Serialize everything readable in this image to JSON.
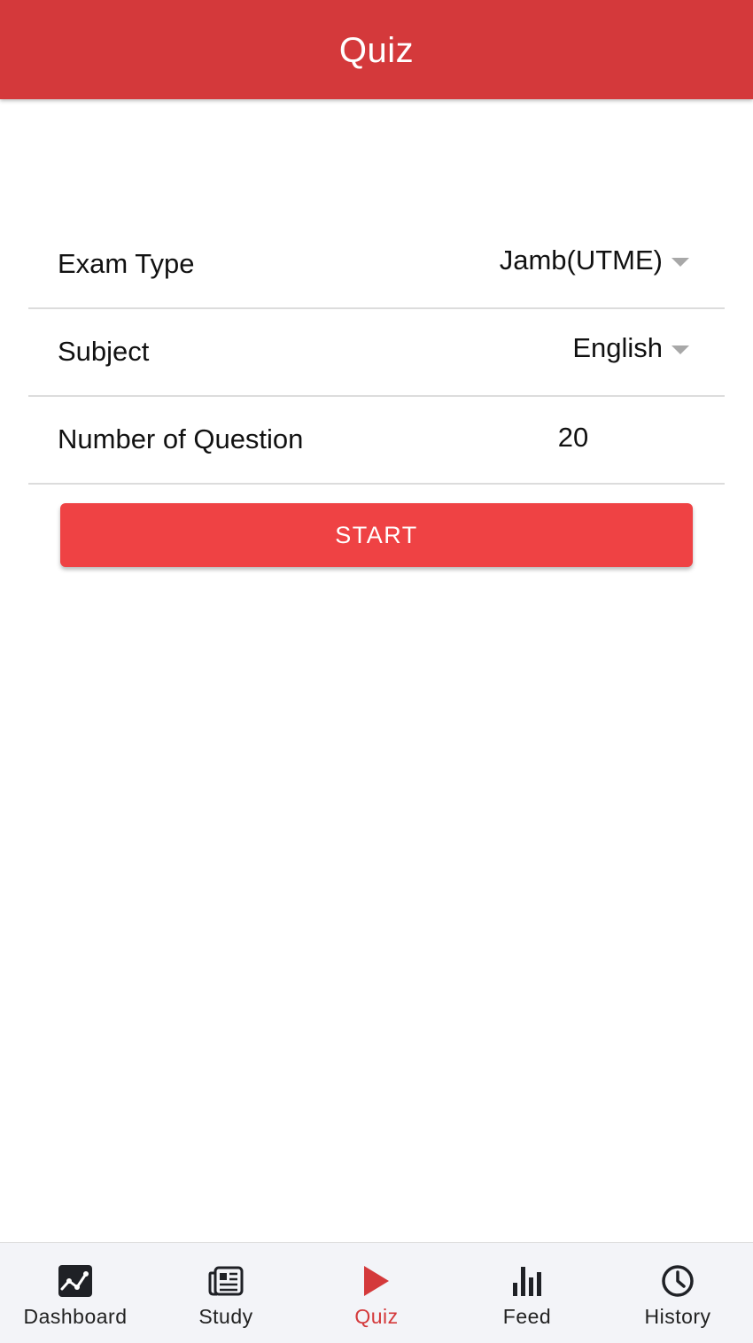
{
  "header": {
    "title": "Quiz",
    "background_color": "#d4393b"
  },
  "form": {
    "exam_type": {
      "label": "Exam Type",
      "value": "Jamb(UTME)"
    },
    "subject": {
      "label": "Subject",
      "value": "English"
    },
    "question_count": {
      "label": "Number of Question",
      "value": "20"
    }
  },
  "start_button": {
    "label": "START",
    "color": "#ef4244"
  },
  "bottom_nav": {
    "active": "Quiz",
    "active_color": "#d4393b",
    "items": [
      {
        "label": "Dashboard",
        "icon": "chart-line-icon"
      },
      {
        "label": "Study",
        "icon": "newspaper-icon"
      },
      {
        "label": "Quiz",
        "icon": "play-icon"
      },
      {
        "label": "Feed",
        "icon": "bar-chart-icon"
      },
      {
        "label": "History",
        "icon": "clock-icon"
      }
    ]
  }
}
